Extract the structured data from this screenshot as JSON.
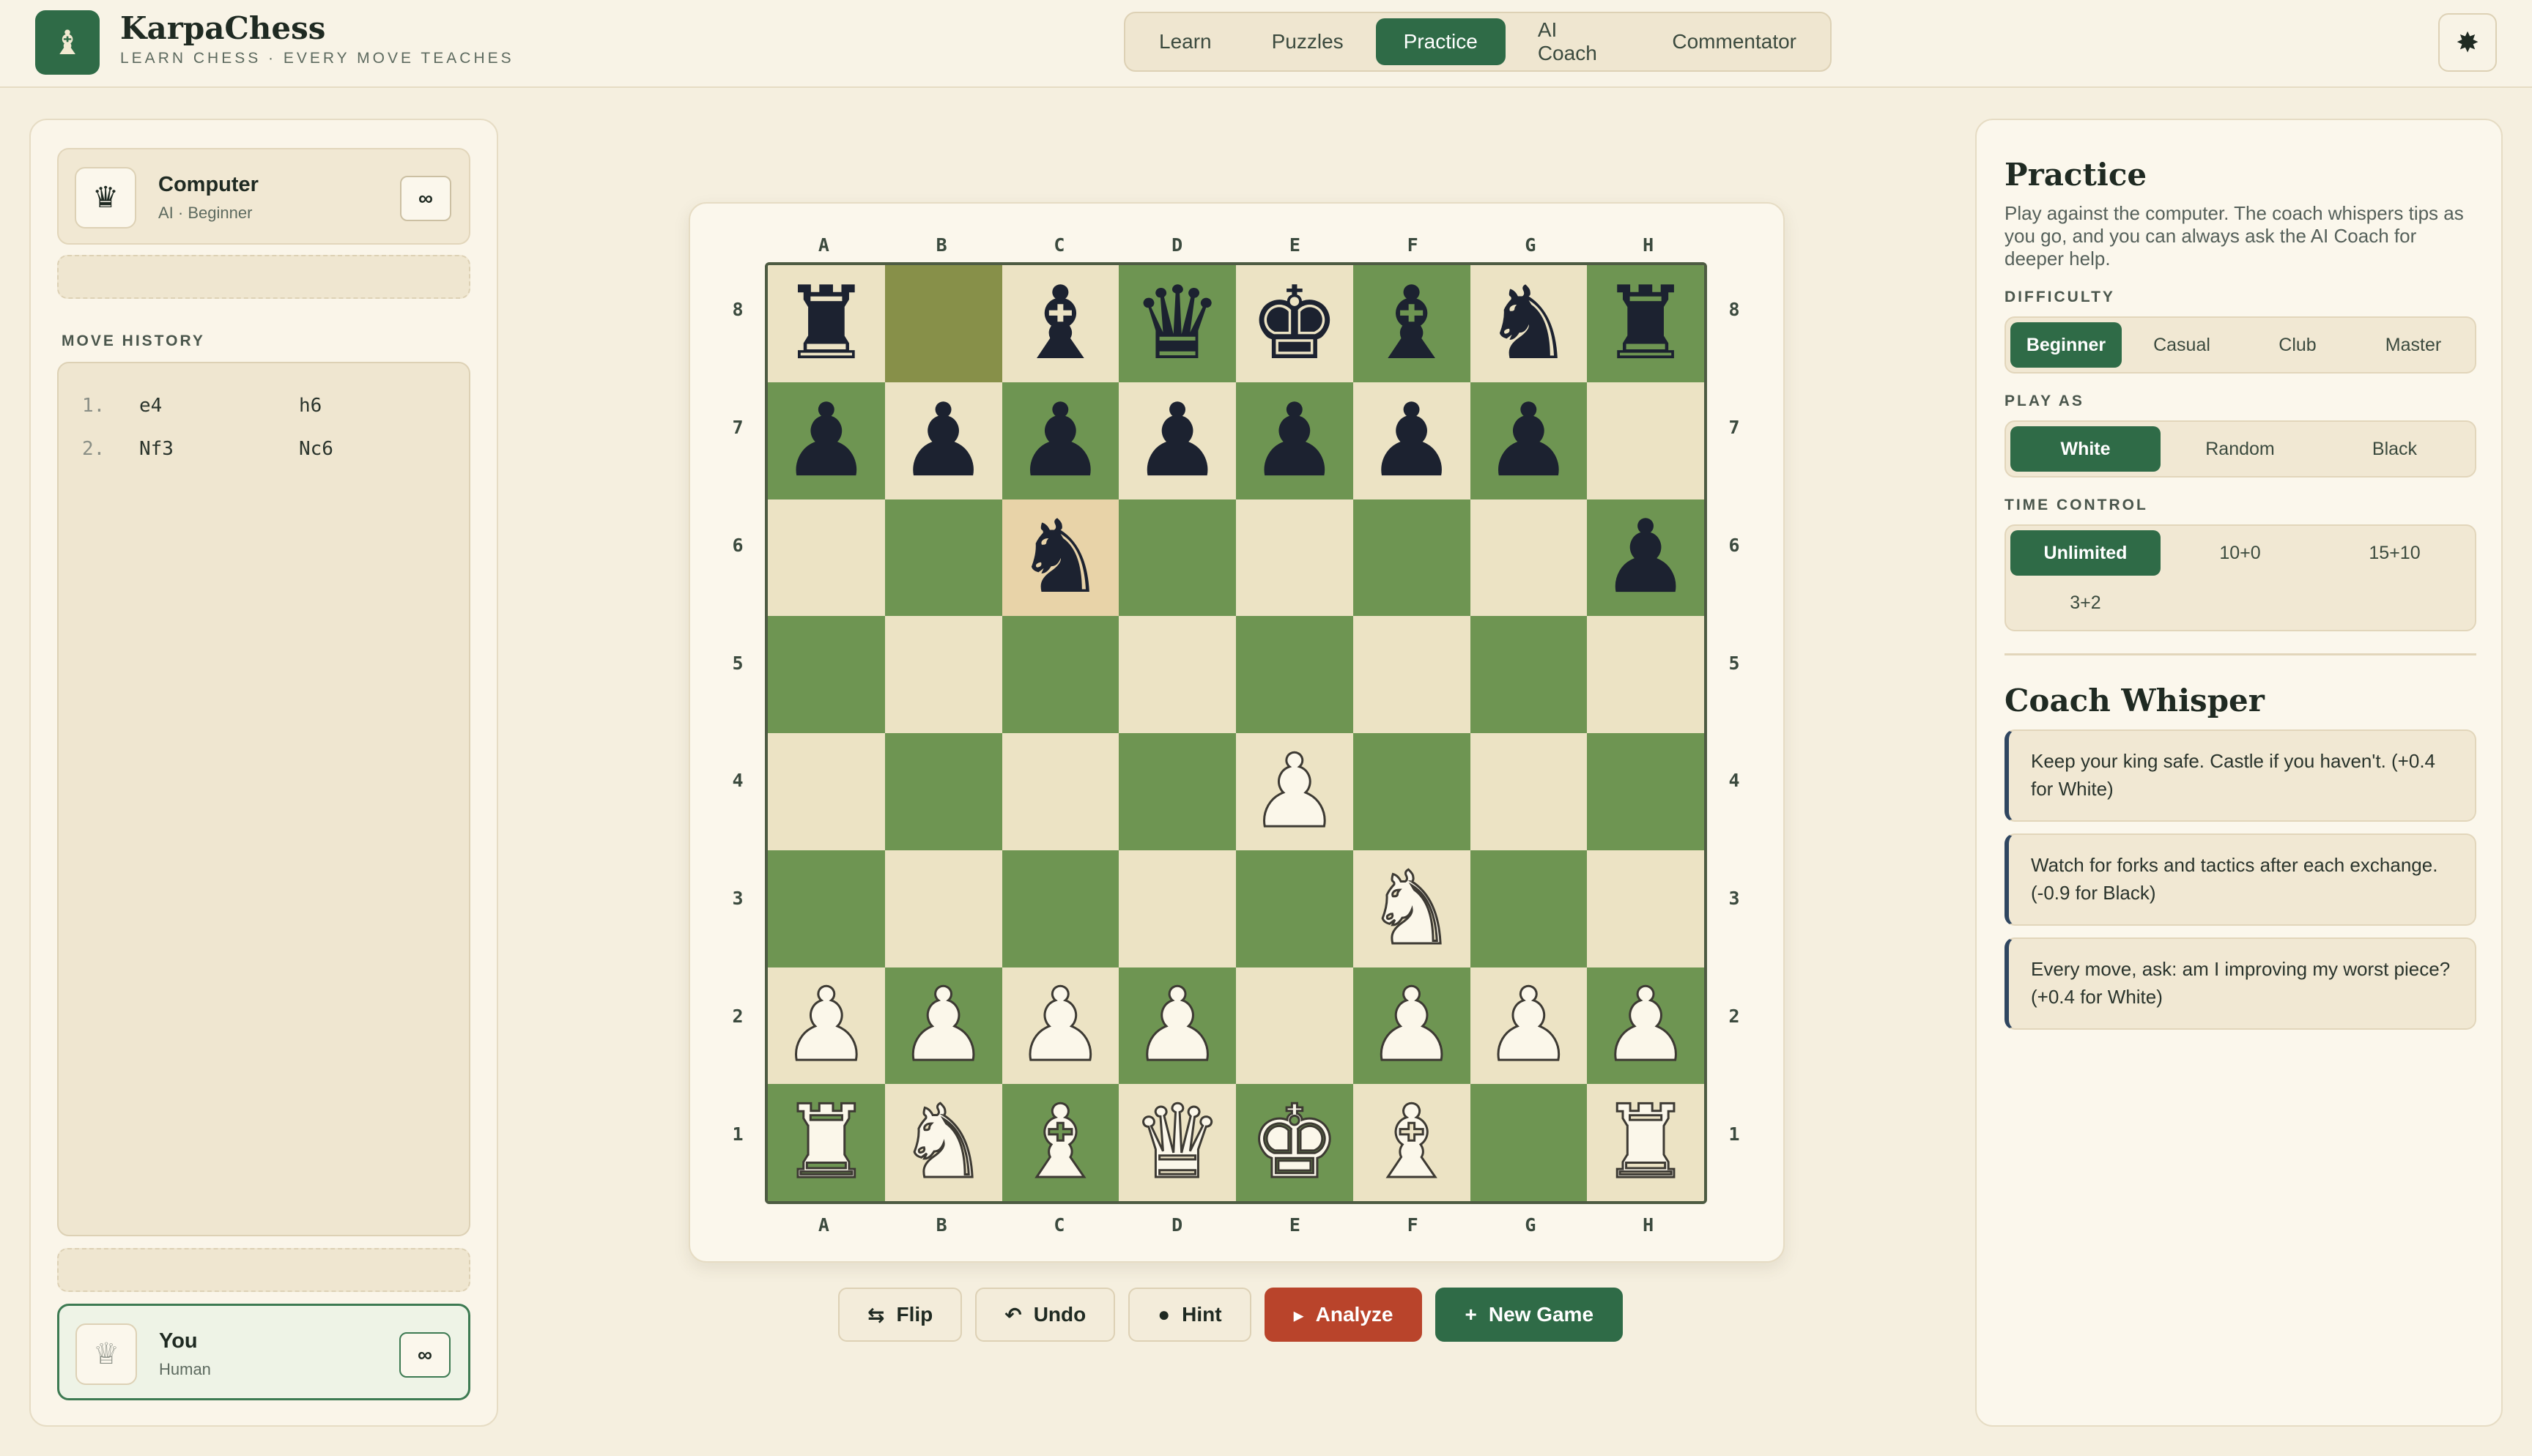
{
  "app": {
    "name": "KarpaChess",
    "tagline": "LEARN CHESS · EVERY MOVE TEACHES",
    "logo_icon": "♝"
  },
  "nav": {
    "tabs": [
      {
        "label": "Learn",
        "active": false
      },
      {
        "label": "Puzzles",
        "active": false
      },
      {
        "label": "Practice",
        "active": true
      },
      {
        "label": "AI Coach",
        "active": false
      },
      {
        "label": "Commentator",
        "active": false
      }
    ]
  },
  "settings_icon": "✸",
  "opponent": {
    "name": "Computer",
    "role": "AI · Beginner",
    "clock": "∞",
    "avatar_icon": "♛"
  },
  "player": {
    "name": "You",
    "role": "Human",
    "clock": "∞",
    "avatar_icon": "♕"
  },
  "move_history": {
    "label": "MOVE HISTORY",
    "moves": [
      {
        "num": "1.",
        "white": "e4",
        "black": "h6"
      },
      {
        "num": "2.",
        "white": "Nf3",
        "black": "Nc6"
      }
    ]
  },
  "board": {
    "files": [
      "A",
      "B",
      "C",
      "D",
      "E",
      "F",
      "G",
      "H"
    ],
    "ranks": [
      "8",
      "7",
      "6",
      "5",
      "4",
      "3",
      "2",
      "1"
    ],
    "position": [
      [
        "bR",
        "",
        "bB",
        "bQ",
        "bK",
        "bB",
        "bN",
        "bR"
      ],
      [
        "bP",
        "bP",
        "bP",
        "bP",
        "bP",
        "bP",
        "bP",
        ""
      ],
      [
        "",
        "",
        "bN",
        "",
        "",
        "",
        "",
        "bP"
      ],
      [
        "",
        "",
        "",
        "",
        "",
        "",
        "",
        ""
      ],
      [
        "",
        "",
        "",
        "",
        "wP",
        "",
        "",
        ""
      ],
      [
        "",
        "",
        "",
        "",
        "",
        "wN",
        "",
        ""
      ],
      [
        "wP",
        "wP",
        "wP",
        "wP",
        "",
        "wP",
        "wP",
        "wP"
      ],
      [
        "wR",
        "wN",
        "wB",
        "wQ",
        "wK",
        "wB",
        "",
        "wR"
      ]
    ],
    "last_move_squares": [
      "b8",
      "c6"
    ],
    "colors": {
      "light": "#ece3c4",
      "dark": "#6e9552"
    }
  },
  "actions": {
    "flip": {
      "label": "Flip",
      "icon": "⇆"
    },
    "undo": {
      "label": "Undo",
      "icon": "↶"
    },
    "hint": {
      "label": "Hint",
      "icon": "●"
    },
    "analyze": {
      "label": "Analyze",
      "icon": "▸"
    },
    "new_game": {
      "label": "New Game",
      "icon": "+"
    }
  },
  "practice": {
    "title": "Practice",
    "description": "Play against the computer. The coach whispers tips as you go, and you can always ask the AI Coach for deeper help.",
    "difficulty": {
      "label": "DIFFICULTY",
      "options": [
        "Beginner",
        "Casual",
        "Club",
        "Master"
      ],
      "selected": "Beginner"
    },
    "play_as": {
      "label": "PLAY AS",
      "options": [
        "White",
        "Random",
        "Black"
      ],
      "selected": "White"
    },
    "time_control": {
      "label": "TIME CONTROL",
      "options": [
        "Unlimited",
        "10+0",
        "15+10",
        "3+2"
      ],
      "selected": "Unlimited"
    }
  },
  "coach_whisper": {
    "title": "Coach Whisper",
    "tips": [
      "Keep your king safe. Castle if you haven't. (+0.4 for White)",
      "Watch for forks and tactics after each exchange. (-0.9 for Black)",
      "Every move, ask: am I improving my worst piece? (+0.4 for White)"
    ]
  },
  "accent_colors": {
    "primary": "#2f6b47",
    "analyze": "#b9442b",
    "background": "#f5efdf"
  }
}
